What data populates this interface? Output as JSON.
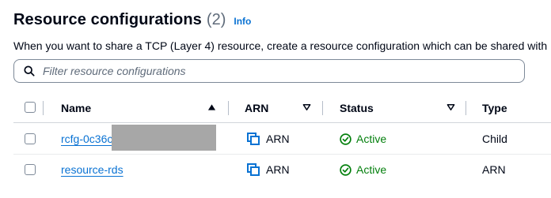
{
  "header": {
    "title": "Resource configurations",
    "count": "(2)",
    "info_link": "Info"
  },
  "description": "When you want to share a TCP (Layer 4) resource, create a resource configuration which can be shared with",
  "search": {
    "placeholder": "Filter resource configurations",
    "value": ""
  },
  "table": {
    "columns": [
      {
        "label": "Name",
        "sort": "ascending"
      },
      {
        "label": "ARN",
        "sort": "none"
      },
      {
        "label": "Status",
        "sort": "none"
      },
      {
        "label": "Type",
        "sort": "none"
      }
    ],
    "rows": [
      {
        "name": "rcfg-0c36c",
        "arn": "ARN",
        "status": "Active",
        "type": "Child",
        "redacted": true
      },
      {
        "name": "resource-rds",
        "arn": "ARN",
        "status": "Active",
        "type": "ARN",
        "redacted": false
      }
    ]
  },
  "colors": {
    "link": "#0972d3",
    "success": "#037f0c",
    "border": "#7d8998",
    "text": "#000716"
  },
  "icons": {
    "search": "search-icon",
    "copy": "copy-icon",
    "status_active": "check-circle-icon",
    "sort_asc": "caret-up-filled-icon",
    "sort_none": "caret-down-outline-icon"
  }
}
